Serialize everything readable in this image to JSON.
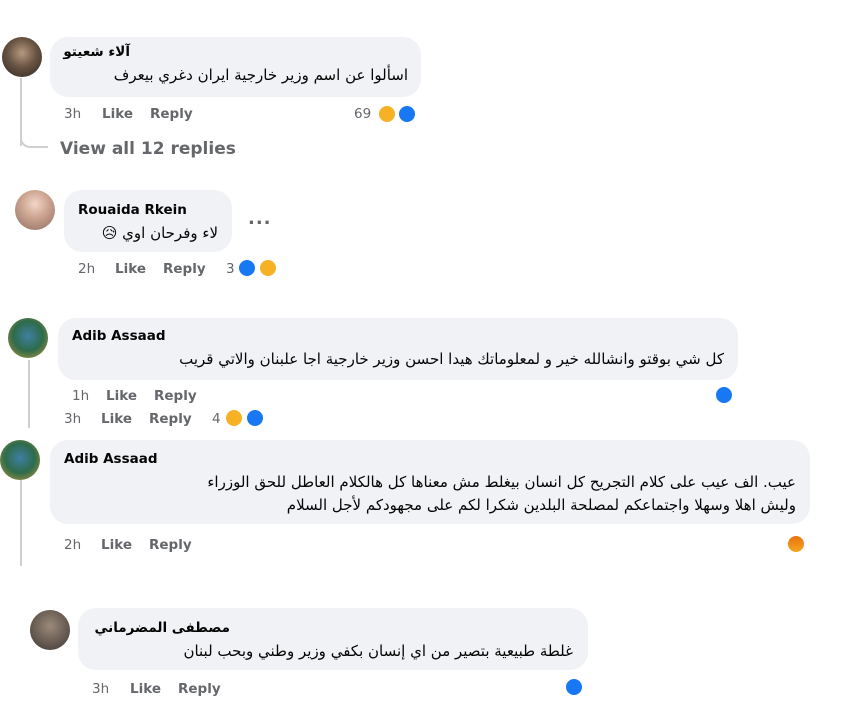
{
  "comments": [
    {
      "name": "آلاء شعيتو",
      "text": "اسألوا عن اسم وزير خارجية ايران دغري بيعرف",
      "time": "3h",
      "like": "Like",
      "reply": "Reply",
      "reaction_count": "69",
      "reactions": [
        "haha-icon",
        "like-icon"
      ]
    },
    {
      "name": "Rouaida Rkein",
      "text": "لاء وفرحان اوي 😥",
      "time": "2h",
      "like": "Like",
      "reply": "Reply",
      "reaction_count": "3",
      "reactions": [
        "like-icon",
        "haha-icon"
      ],
      "more": "..."
    },
    {
      "name": "Adib Assaad",
      "text": "كل شي بوقتو وانشالله خير و لمعلوماتك هيدا احسن وزير خارجية اجا علبنان والاتي قريب",
      "time": "1h",
      "like": "Like",
      "reply": "Reply",
      "time2": "3h",
      "like2": "Like",
      "reply2": "Reply",
      "reaction_count": "4",
      "reactions": [
        "haha-icon",
        "like-icon"
      ]
    },
    {
      "name": "Adib Assaad",
      "text_line1": "عيب. الف عيب على كلام التجريح كل انسان بيغلط مش معناها كل هالكلام العاطل للحق الوزراء",
      "text_line2": "وليش اهلا وسهلا واجتماعكم لمصلحة البلدين شكرا لكم على مجهودكم لأجل السلام",
      "time": "2h",
      "like": "Like",
      "reply": "Reply",
      "reactions": [
        "angry-icon"
      ]
    },
    {
      "name": "مصطفى المضرماني",
      "text": "غلطة طبيعية بتصير من اي إنسان بكفي وزير وطني وبحب لبنان",
      "time": "3h",
      "like": "Like",
      "reply": "Reply",
      "reactions": [
        "like-icon"
      ]
    }
  ],
  "view_all_replies": "View all 12 replies",
  "colors": {
    "like": "#1877f2",
    "haha": "#f7b125",
    "angry": "#e9710f",
    "bubble": "#f0f2f5",
    "meta": "#65676b"
  }
}
